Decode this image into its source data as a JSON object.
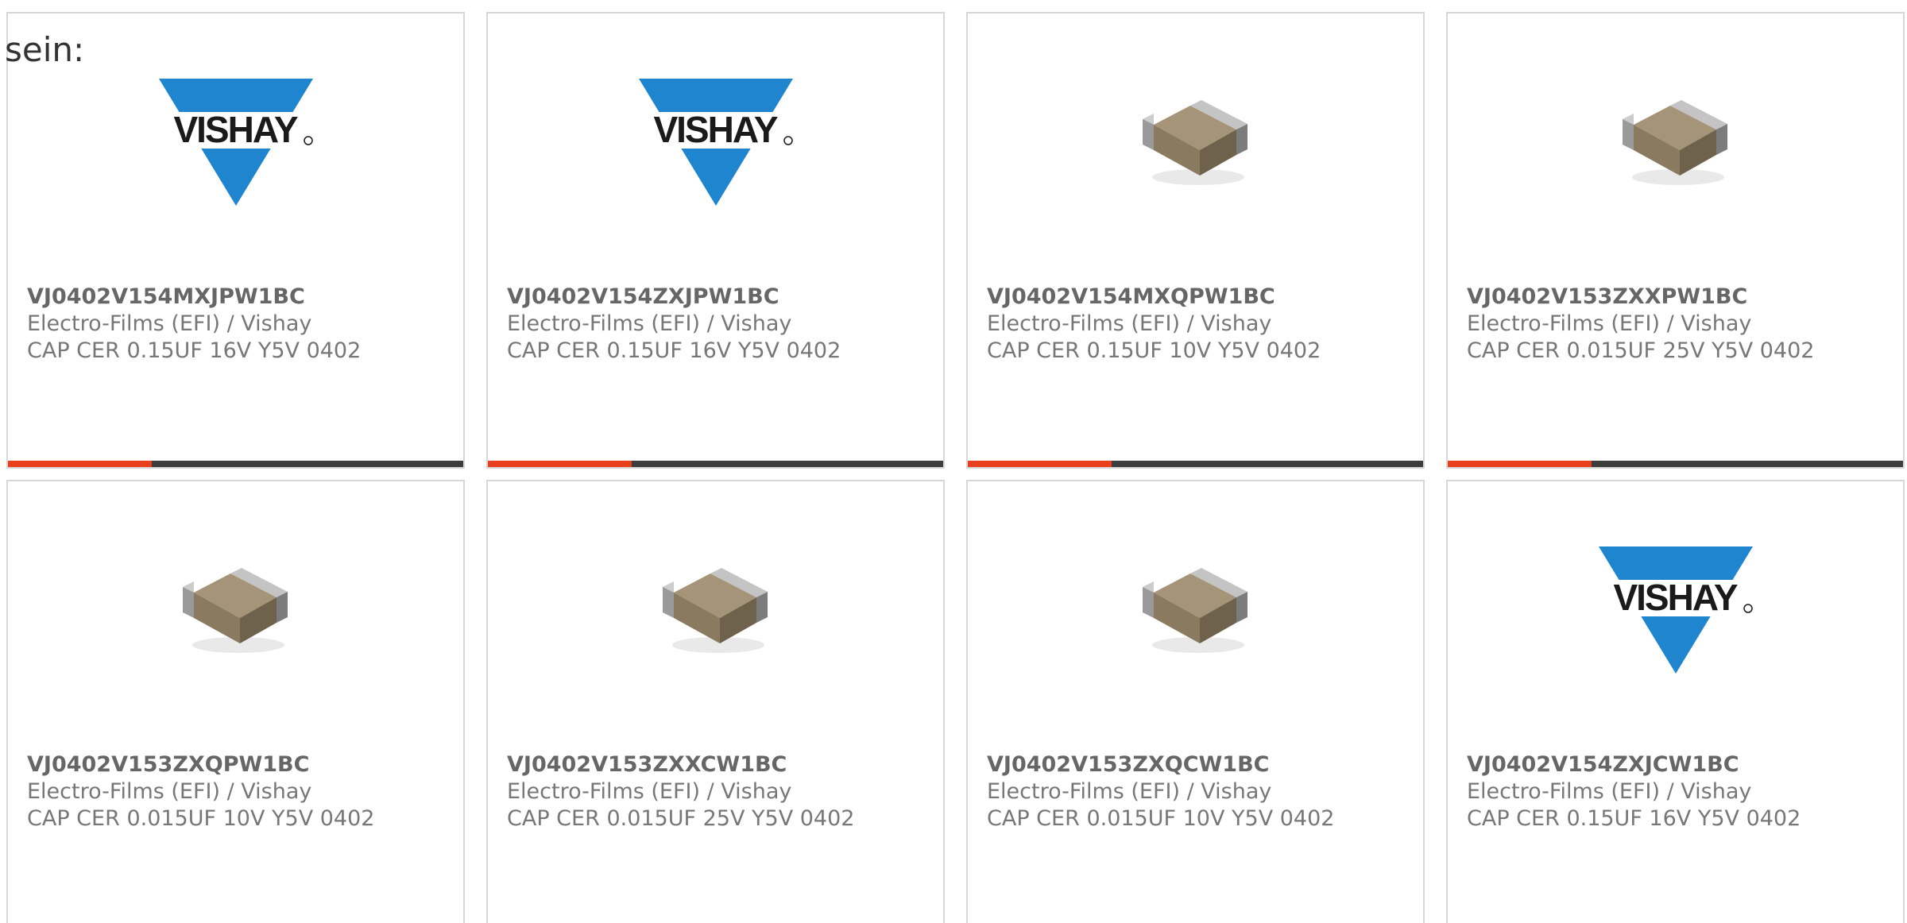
{
  "intro_text": "sein:",
  "colors": {
    "accent": "#e8401c",
    "bar_track": "#3d3d3d",
    "border": "#d7d7d7",
    "text": "#777777",
    "vishay_blue": "#1f85cf"
  },
  "products": [
    {
      "part_number": "VJ0402V154MXJPW1BC",
      "manufacturer": "Electro-Films (EFI) / Vishay",
      "description": "CAP CER 0.15UF 16V Y5V 0402",
      "image": "vishay-logo",
      "logo_text": "VISHAY",
      "bar_fill": 0.316
    },
    {
      "part_number": "VJ0402V154ZXJPW1BC",
      "manufacturer": "Electro-Films (EFI) / Vishay",
      "description": "CAP CER 0.15UF 16V Y5V 0402",
      "image": "vishay-logo",
      "logo_text": "VISHAY",
      "bar_fill": 0.316
    },
    {
      "part_number": "VJ0402V154MXQPW1BC",
      "manufacturer": "Electro-Films (EFI) / Vishay",
      "description": "CAP CER 0.15UF 10V Y5V 0402",
      "image": "ceramic-capacitor-chip",
      "bar_fill": 0.316
    },
    {
      "part_number": "VJ0402V153ZXXPW1BC",
      "manufacturer": "Electro-Films (EFI) / Vishay",
      "description": "CAP CER 0.015UF 25V Y5V 0402",
      "image": "ceramic-capacitor-chip",
      "bar_fill": 0.316
    },
    {
      "part_number": "VJ0402V153ZXQPW1BC",
      "manufacturer": "Electro-Films (EFI) / Vishay",
      "description": "CAP CER 0.015UF 10V Y5V 0402",
      "image": "ceramic-capacitor-chip"
    },
    {
      "part_number": "VJ0402V153ZXXCW1BC",
      "manufacturer": "Electro-Films (EFI) / Vishay",
      "description": "CAP CER 0.015UF 25V Y5V 0402",
      "image": "ceramic-capacitor-chip"
    },
    {
      "part_number": "VJ0402V153ZXQCW1BC",
      "manufacturer": "Electro-Films (EFI) / Vishay",
      "description": "CAP CER 0.015UF 10V Y5V 0402",
      "image": "ceramic-capacitor-chip"
    },
    {
      "part_number": "VJ0402V154ZXJCW1BC",
      "manufacturer": "Electro-Films (EFI) / Vishay",
      "description": "CAP CER 0.15UF 16V Y5V 0402",
      "image": "vishay-logo",
      "logo_text": "VISHAY"
    }
  ]
}
